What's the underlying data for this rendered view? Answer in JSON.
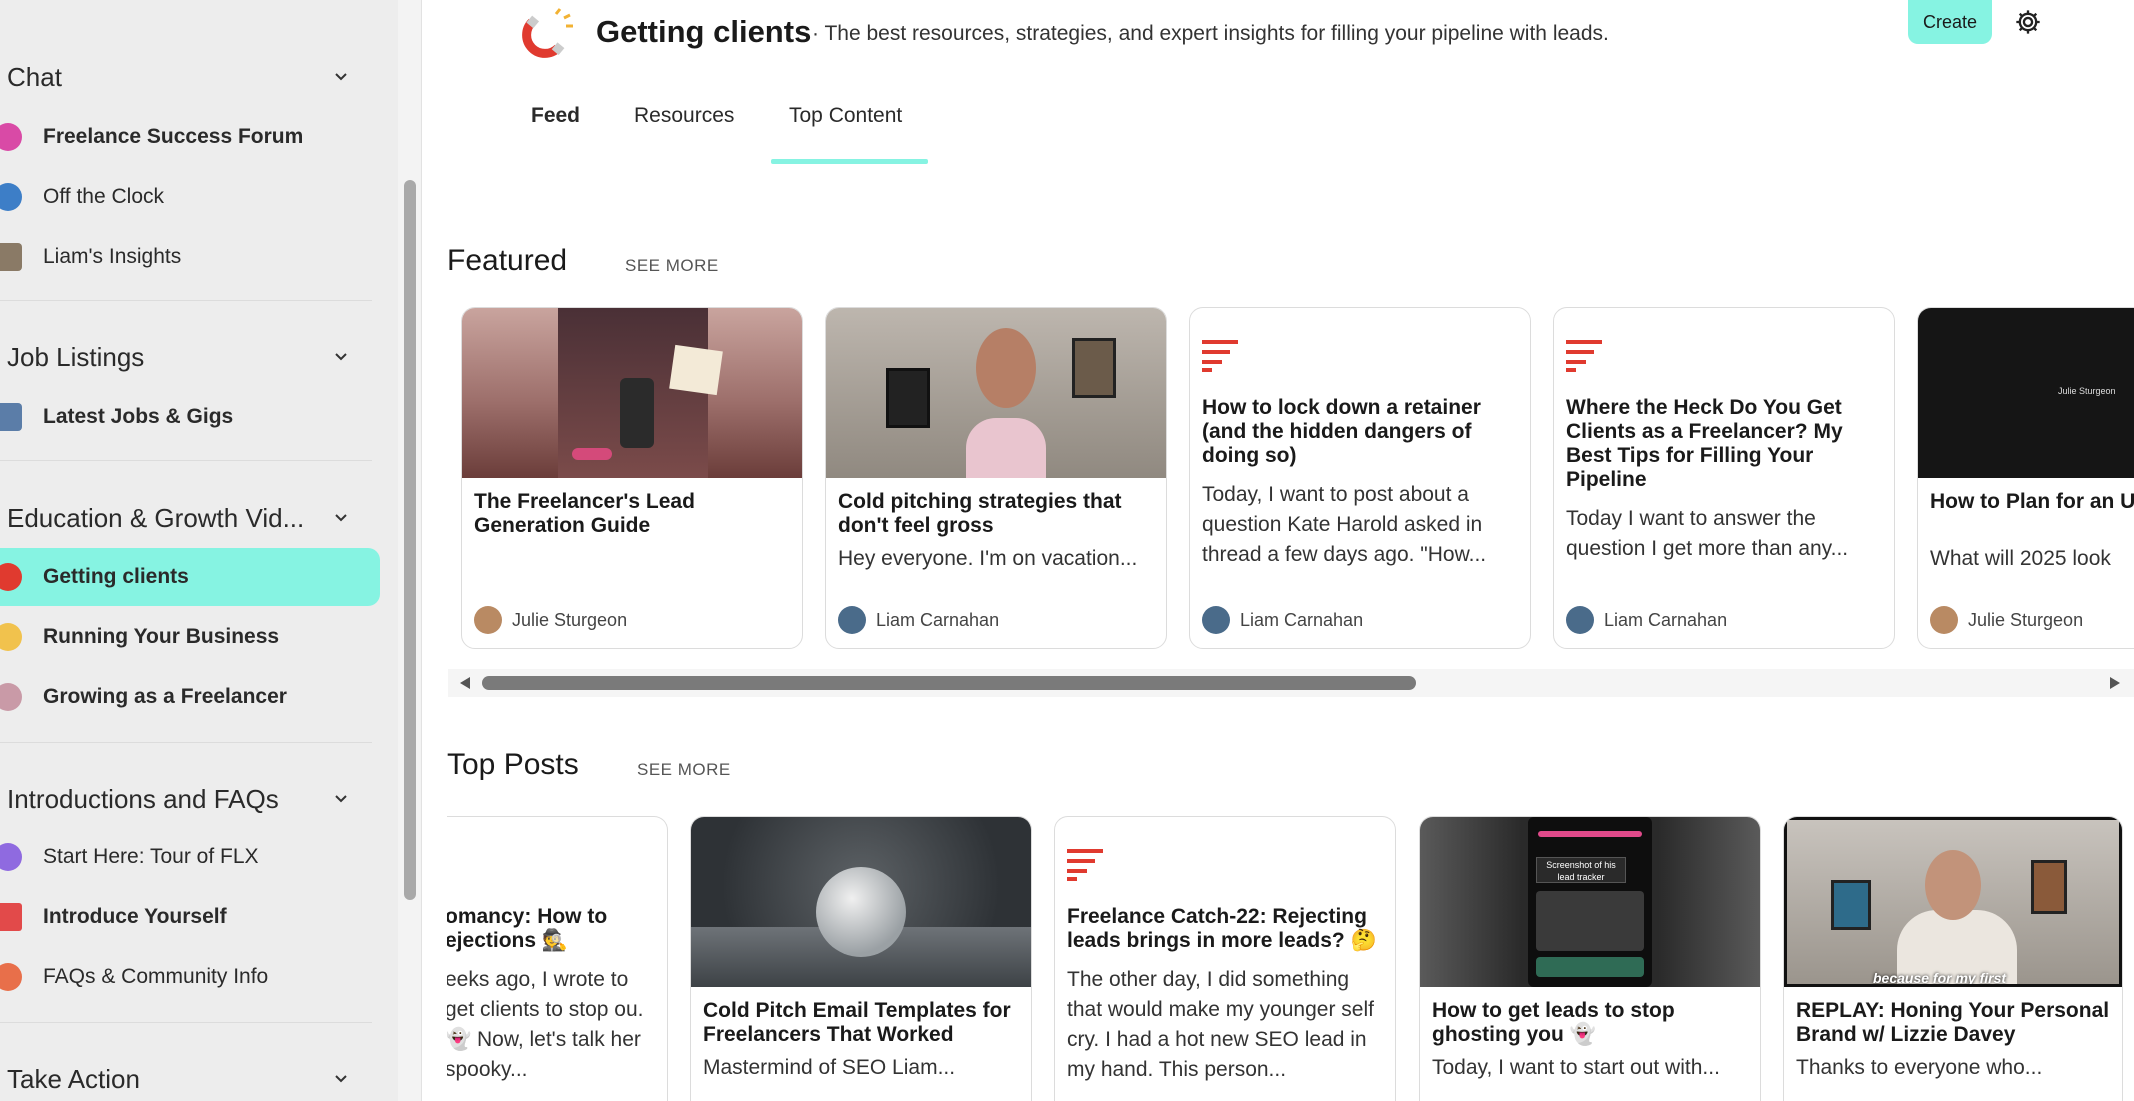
{
  "sidebar": {
    "sections": [
      {
        "title": "Chat",
        "items": [
          {
            "label": "Freelance Success Forum",
            "bold": true,
            "icon": "chat-bubble-icon"
          },
          {
            "label": "Off the Clock",
            "bold": false,
            "icon": "coffee-icon"
          },
          {
            "label": "Liam's Insights",
            "bold": false,
            "icon": "person-photo-icon"
          }
        ]
      },
      {
        "title": "Job Listings",
        "items": [
          {
            "label": "Latest Jobs & Gigs",
            "bold": true,
            "icon": "computer-icon"
          }
        ]
      },
      {
        "title": "Education & Growth Vid...",
        "items": [
          {
            "label": "Getting clients",
            "bold": true,
            "active": true,
            "icon": "magnet-icon"
          },
          {
            "label": "Running Your Business",
            "bold": true,
            "icon": "ideas-icon"
          },
          {
            "label": "Growing as a Freelancer",
            "bold": true,
            "icon": "tree-icon"
          }
        ]
      },
      {
        "title": "Introductions and FAQs",
        "items": [
          {
            "label": "Start Here: Tour of FLX",
            "bold": false,
            "icon": "globe-icon"
          },
          {
            "label": "Introduce Yourself",
            "bold": true,
            "icon": "nametag-icon"
          },
          {
            "label": "FAQs & Community Info",
            "bold": false,
            "icon": "info-icon"
          }
        ]
      },
      {
        "title": "Take Action",
        "items": []
      }
    ]
  },
  "header": {
    "title": "Getting clients",
    "description": "· The best resources, strategies, and expert insights for filling your pipeline with leads.",
    "create_label": "Create"
  },
  "tabs": [
    {
      "label": "Feed",
      "bold": true
    },
    {
      "label": "Resources",
      "bold": false
    },
    {
      "label": "Top Content",
      "bold": false,
      "active": true
    }
  ],
  "featured": {
    "title": "Featured",
    "see_more": "SEE MORE",
    "cards": [
      {
        "title": "The Freelancer's Lead Generation Guide",
        "snippet": "",
        "author": "Julie Sturgeon",
        "media": "guidebook-image"
      },
      {
        "title": "Cold pitching strategies that don't feel gross",
        "snippet": "Hey everyone. I'm on vacation...",
        "author": "Liam Carnahan",
        "media": "video-thumbnail"
      },
      {
        "title": "How to lock down a retainer (and the hidden dangers of doing so)",
        "snippet": " Today, I want to post about a question Kate Harold asked in thread a few days ago.  \"How...",
        "author": "Liam Carnahan",
        "media": "post-icon"
      },
      {
        "title": "Where the Heck Do You Get Clients as a Freelancer? My Best Tips for Filling Your Pipeline",
        "snippet": "Today I want to answer the question I get more than any...",
        "author": "Liam Carnahan",
        "media": "post-icon"
      },
      {
        "title": "How to Plan for an U Future",
        "snippet": "What will 2025 look",
        "author": "Julie Sturgeon",
        "media": "dark-video",
        "overlay": "Julie Sturgeon"
      }
    ]
  },
  "top_posts": {
    "title": "Top Posts",
    "see_more": "SEE MORE",
    "cards": [
      {
        "title": "omancy: How to ejections 🕵",
        "snippet": "eeks ago, I wrote to get clients to stop ou. 👻 Now, let's talk her spooky...",
        "media": "none"
      },
      {
        "title": "Cold Pitch Email Templates for Freelancers That Worked",
        "snippet": "Mastermind of SEO Liam...",
        "media": "frozen-bubble-image"
      },
      {
        "title": "Freelance Catch-22: Rejecting leads brings in more leads? 🤔",
        "snippet": "The other day, I did something that would make my younger self cry. I had a hot new SEO lead in my hand. This person...",
        "media": "post-icon"
      },
      {
        "title": "How to get leads to stop ghosting you 👻",
        "snippet": "Today, I want to start out with...",
        "media": "phone-screenshot",
        "overlay_title": "Screenshot of his lead tracker"
      },
      {
        "title": "REPLAY: Honing Your Personal Brand w/ Lizzie Davey",
        "snippet": "Thanks to everyone who...",
        "media": "video-thumbnail",
        "caption": "because for my first"
      }
    ]
  },
  "colors": {
    "accent": "#86f3e2",
    "brand_red": "#e03a2f"
  }
}
